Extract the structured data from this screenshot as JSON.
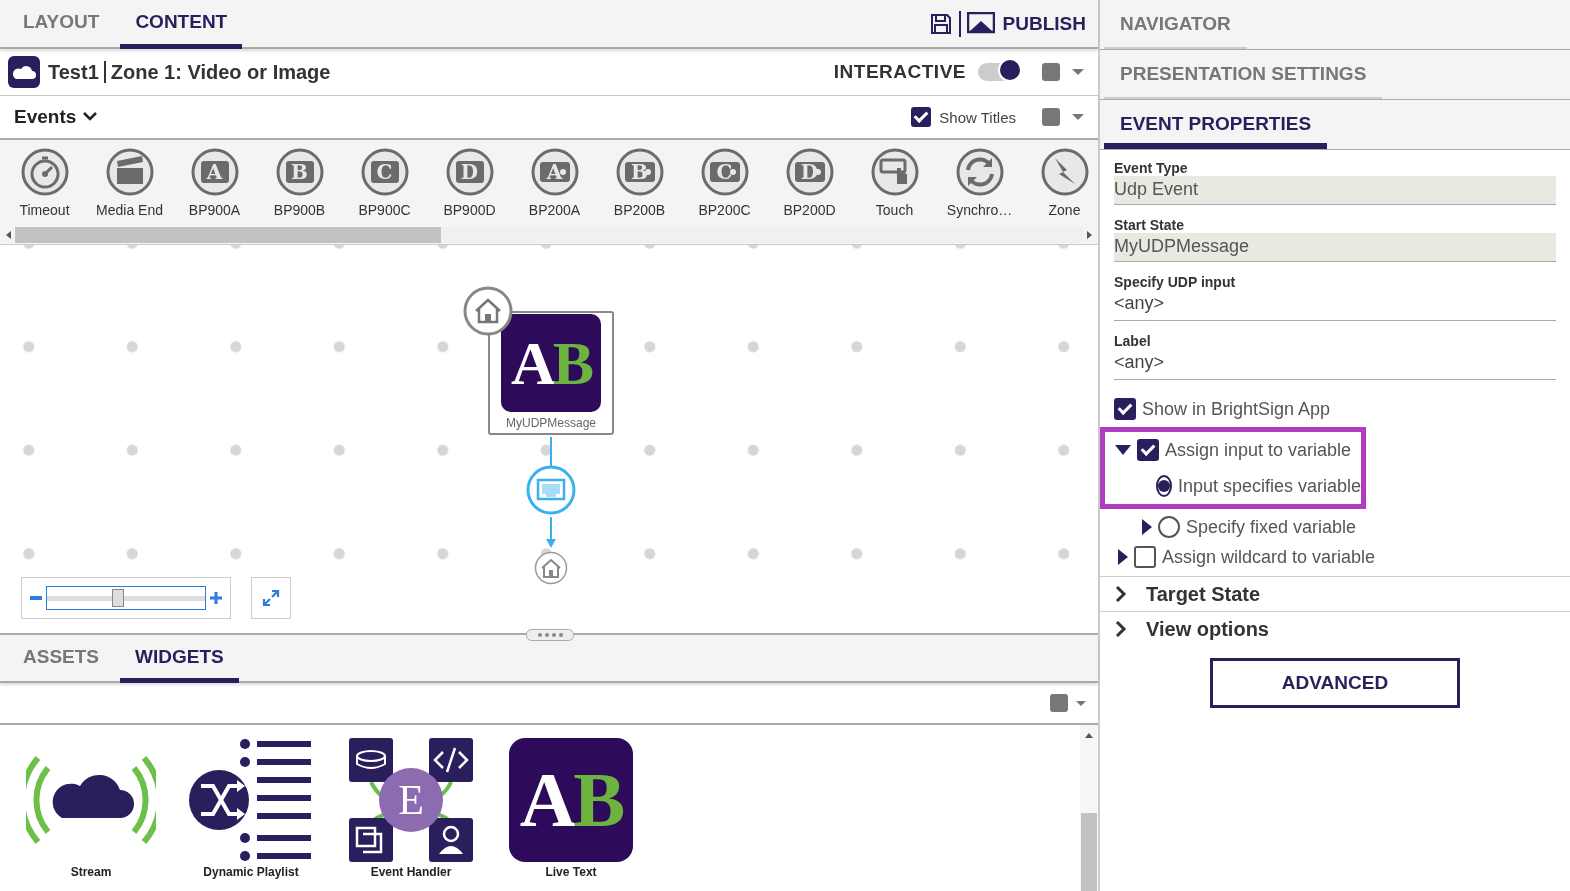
{
  "top_tabs": [
    {
      "label": "LAYOUT",
      "selected": false
    },
    {
      "label": "CONTENT",
      "selected": true
    }
  ],
  "publish": {
    "label": "PUBLISH"
  },
  "zone": {
    "project": "Test1",
    "title": "Zone 1: Video or Image",
    "mode_label": "INTERACTIVE",
    "interactive_on": true
  },
  "events_bar": {
    "title": "Events",
    "show_titles": {
      "label": "Show Titles",
      "checked": true
    }
  },
  "event_types": [
    {
      "kind": "timeout",
      "label": "Timeout"
    },
    {
      "kind": "media",
      "label": "Media End"
    },
    {
      "kind": "bp900",
      "glyph": "A",
      "label": "BP900A"
    },
    {
      "kind": "bp900",
      "glyph": "B",
      "label": "BP900B"
    },
    {
      "kind": "bp900",
      "glyph": "C",
      "label": "BP900C"
    },
    {
      "kind": "bp900",
      "glyph": "D",
      "label": "BP900D"
    },
    {
      "kind": "bp200",
      "glyph": "A",
      "label": "BP200A"
    },
    {
      "kind": "bp200",
      "glyph": "B",
      "label": "BP200B"
    },
    {
      "kind": "bp200",
      "glyph": "C",
      "label": "BP200C"
    },
    {
      "kind": "bp200",
      "glyph": "D",
      "label": "BP200D"
    },
    {
      "kind": "touch",
      "label": "Touch"
    },
    {
      "kind": "sync",
      "label": "Synchro…"
    },
    {
      "kind": "zone",
      "label": "Zone"
    }
  ],
  "canvas": {
    "state": {
      "label": "MyUDPMessage",
      "letters": [
        {
          "char": "A",
          "color": "#ffffff"
        },
        {
          "char": "B",
          "color": "#6db33f"
        }
      ]
    },
    "zoom": {
      "level": 0.45
    }
  },
  "bottom_tabs": [
    {
      "label": "ASSETS",
      "selected": false
    },
    {
      "label": "WIDGETS",
      "selected": true
    }
  ],
  "widgets": [
    {
      "kind": "stream",
      "label": "Stream"
    },
    {
      "kind": "playlist",
      "label": "Dynamic Playlist"
    },
    {
      "kind": "handler",
      "label": "Event Handler",
      "letter": "E"
    },
    {
      "kind": "livetext",
      "label": "Live Text",
      "letters": [
        {
          "char": "A",
          "color": "#ffffff"
        },
        {
          "char": "B",
          "color": "#6db33f"
        }
      ]
    }
  ],
  "side_tabs": [
    {
      "label": "NAVIGATOR",
      "selected": false
    },
    {
      "label": "PRESENTATION SETTINGS",
      "selected": false
    },
    {
      "label": "EVENT PROPERTIES",
      "selected": true
    }
  ],
  "fields": [
    {
      "label": "Event Type",
      "value": "Udp Event",
      "disabled": true
    },
    {
      "label": "Start State",
      "value": "MyUDPMessage",
      "disabled": true
    },
    {
      "label": "Specify UDP input",
      "value": "<any>",
      "disabled": false
    },
    {
      "label": "Label",
      "value": "<any>",
      "disabled": false
    }
  ],
  "options": [
    {
      "kind": "checkbox",
      "label": "Show in BrightSign App",
      "checked": true,
      "highlighted": false
    },
    {
      "kind": "checkbox",
      "label": "Assign input to variable",
      "checked": true,
      "expanded": true,
      "highlighted": true,
      "children": [
        {
          "kind": "radio",
          "label": "Input specifies variable",
          "selected": true,
          "highlighted": true
        },
        {
          "kind": "radio",
          "label": "Specify fixed variable",
          "selected": false,
          "expanded": false,
          "highlighted": false
        }
      ]
    },
    {
      "kind": "checkbox",
      "label": "Assign wildcard to variable",
      "checked": false,
      "expanded": false,
      "highlighted": false
    }
  ],
  "sections": [
    {
      "label": "Target State",
      "expanded": false
    },
    {
      "label": "View options",
      "expanded": false
    }
  ],
  "advanced_button": "ADVANCED"
}
